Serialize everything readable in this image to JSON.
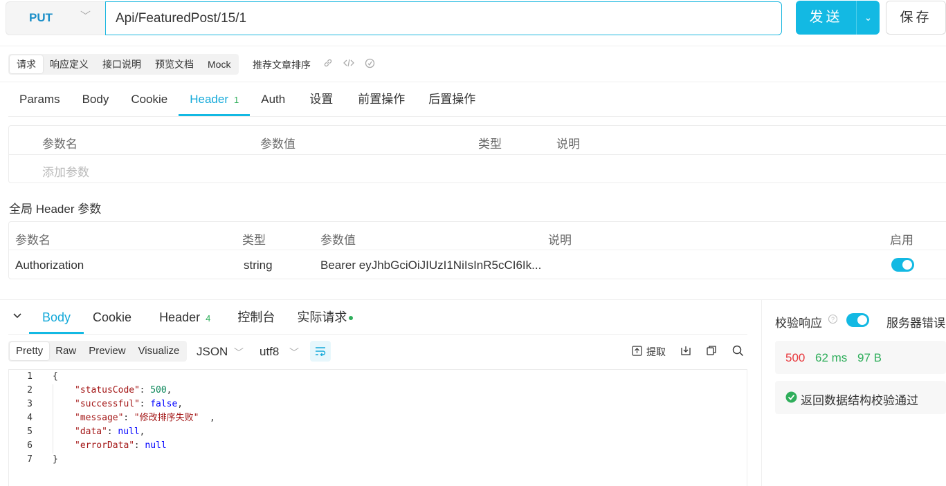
{
  "request": {
    "method": "PUT",
    "url": "Api/FeaturedPost/15/1",
    "send_label": "发送",
    "save_label": "保存"
  },
  "doc_tabs": [
    "请求",
    "响应定义",
    "接口说明",
    "预览文档",
    "Mock"
  ],
  "api_name": "推荐文章排序",
  "req_tabs": [
    {
      "label": "Params"
    },
    {
      "label": "Body"
    },
    {
      "label": "Cookie"
    },
    {
      "label": "Header",
      "count": "1"
    },
    {
      "label": "Auth"
    },
    {
      "label": "设置"
    },
    {
      "label": "前置操作"
    },
    {
      "label": "后置操作"
    }
  ],
  "header_table": {
    "columns": [
      "参数名",
      "参数值",
      "类型",
      "说明"
    ],
    "add_placeholder": "添加参数"
  },
  "global_header": {
    "title": "全局 Header 参数",
    "columns": [
      "参数名",
      "类型",
      "参数值",
      "说明",
      "启用"
    ],
    "rows": [
      {
        "name": "Authorization",
        "type": "string",
        "value": "Bearer eyJhbGciOiJIUzI1NiIsInR5cCI6Ik...",
        "desc": "",
        "enabled": true
      }
    ]
  },
  "resp_tabs": [
    {
      "label": "Body"
    },
    {
      "label": "Cookie"
    },
    {
      "label": "Header",
      "count": "4"
    },
    {
      "label": "控制台"
    },
    {
      "label": "实际请求"
    }
  ],
  "format_tabs": [
    "Pretty",
    "Raw",
    "Preview",
    "Visualize"
  ],
  "format": "JSON",
  "encoding": "utf8",
  "extract_label": "提取",
  "code_lines": [
    "1",
    "2",
    "3",
    "4",
    "5",
    "6",
    "7"
  ],
  "response_json": {
    "open_brace": "{",
    "close_brace": "}",
    "fields": [
      {
        "key": "\"statusCode\"",
        "value": "500",
        "kind": "n",
        "comma": ","
      },
      {
        "key": "\"successful\"",
        "value": "false",
        "kind": "b",
        "comma": ","
      },
      {
        "key": "\"message\"",
        "value": "\"修改排序失败\"",
        "kind": "s",
        "comma": ","
      },
      {
        "key": "\"data\"",
        "value": "null",
        "kind": "b",
        "comma": ","
      },
      {
        "key": "\"errorData\"",
        "value": "null",
        "kind": "b",
        "comma": ""
      }
    ]
  },
  "sidebar": {
    "validate_label": "校验响应",
    "server_error_label": "服务器错误",
    "status_code": "500",
    "time": "62 ms",
    "size": "97 B",
    "validation_result": "返回数据结构校验通过"
  },
  "colors": {
    "accent": "#13b9e3",
    "status_error": "#e8383d",
    "success": "#2fae5b"
  }
}
